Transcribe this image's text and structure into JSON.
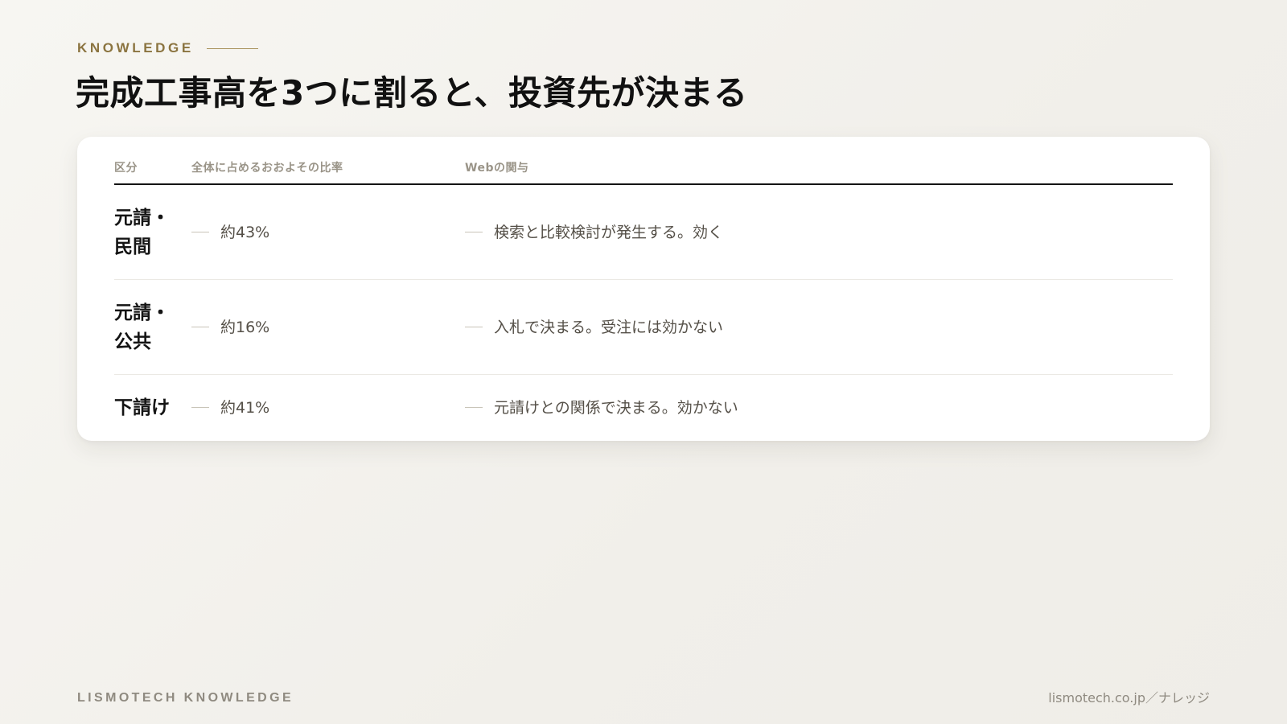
{
  "header": {
    "eyebrow": "KNOWLEDGE",
    "title": "完成工事高を3つに割ると、投資先が決まる"
  },
  "table": {
    "columns": [
      "区分",
      "全体に占めるおおよその比率",
      "Webの関与"
    ],
    "rows": [
      {
        "category": "元請・\n民間",
        "ratio": "約43%",
        "web": "検索と比較検討が発生する。効く"
      },
      {
        "category": "元請・\n公共",
        "ratio": "約16%",
        "web": "入札で決まる。受注には効かない"
      },
      {
        "category": "下請け",
        "ratio": "約41%",
        "web": "元請けとの関係で決まる。効かない"
      }
    ]
  },
  "footer": {
    "brand": "LISMOTECH KNOWLEDGE",
    "link": "lismotech.co.jp／ナレッジ"
  },
  "colors": {
    "accent": "#8b7440",
    "text": "#141414",
    "muted": "#9a9488",
    "background": "#f4f2ee"
  }
}
